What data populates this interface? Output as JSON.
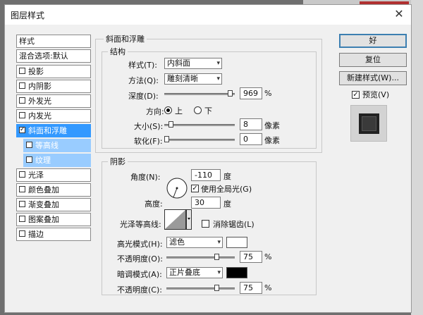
{
  "title": "图层样式",
  "close_glyph": "✕",
  "style_list": {
    "header": "样式",
    "blend_options": "混合选项:默认",
    "items": [
      {
        "label": "投影",
        "checked": false
      },
      {
        "label": "内阴影",
        "checked": false
      },
      {
        "label": "外发光",
        "checked": false
      },
      {
        "label": "内发光",
        "checked": false
      },
      {
        "label": "斜面和浮雕",
        "checked": true,
        "selected": true
      },
      {
        "label": "等高线",
        "checked": false,
        "sub": true
      },
      {
        "label": "纹理",
        "checked": false,
        "sub": true
      },
      {
        "label": "光泽",
        "checked": false
      },
      {
        "label": "颜色叠加",
        "checked": false
      },
      {
        "label": "渐变叠加",
        "checked": false
      },
      {
        "label": "图案叠加",
        "checked": false
      },
      {
        "label": "描边",
        "checked": false
      }
    ]
  },
  "bevel": {
    "section_title": "斜面和浮雕",
    "structure_title": "结构",
    "style_label": "样式(T):",
    "style_value": "内斜面",
    "method_label": "方法(Q):",
    "method_value": "雕刻清晰",
    "depth_label": "深度(D):",
    "depth_value": "969",
    "depth_unit": "%",
    "direction_label": "方向:",
    "direction_up": "上",
    "direction_down": "下",
    "direction_selected": "上",
    "size_label": "大小(S):",
    "size_value": "8",
    "size_unit": "像素",
    "soften_label": "软化(F):",
    "soften_value": "0",
    "soften_unit": "像素"
  },
  "shading": {
    "title": "阴影",
    "angle_label": "角度(N):",
    "angle_value": "-110",
    "angle_unit": "度",
    "global_light_label": "使用全局光(G)",
    "global_light_checked": true,
    "altitude_label": "高度:",
    "altitude_value": "30",
    "altitude_unit": "度",
    "gloss_label": "光泽等高线:",
    "antialias_label": "消除锯齿(L)",
    "highlight_mode_label": "高光模式(H):",
    "highlight_mode_value": "滤色",
    "highlight_color": "#ffffff",
    "highlight_opacity_label": "不透明度(O):",
    "highlight_opacity_value": "75",
    "shadow_mode_label": "暗调模式(A):",
    "shadow_mode_value": "正片叠底",
    "shadow_color": "#000000",
    "shadow_opacity_label": "不透明度(C):",
    "shadow_opacity_value": "75",
    "percent": "%"
  },
  "buttons": {
    "ok": "好",
    "reset": "复位",
    "new_style": "新建样式(W)...",
    "preview_label": "预览(V)",
    "preview_checked": true
  },
  "slider_levels": {
    "depth": 0.97,
    "size": 0.06,
    "soften": 0.0,
    "highlight_opacity": 0.75,
    "shadow_opacity": 0.75
  },
  "colors": {
    "selected_row": "#3399ff",
    "sub_row": "#99ccff"
  }
}
